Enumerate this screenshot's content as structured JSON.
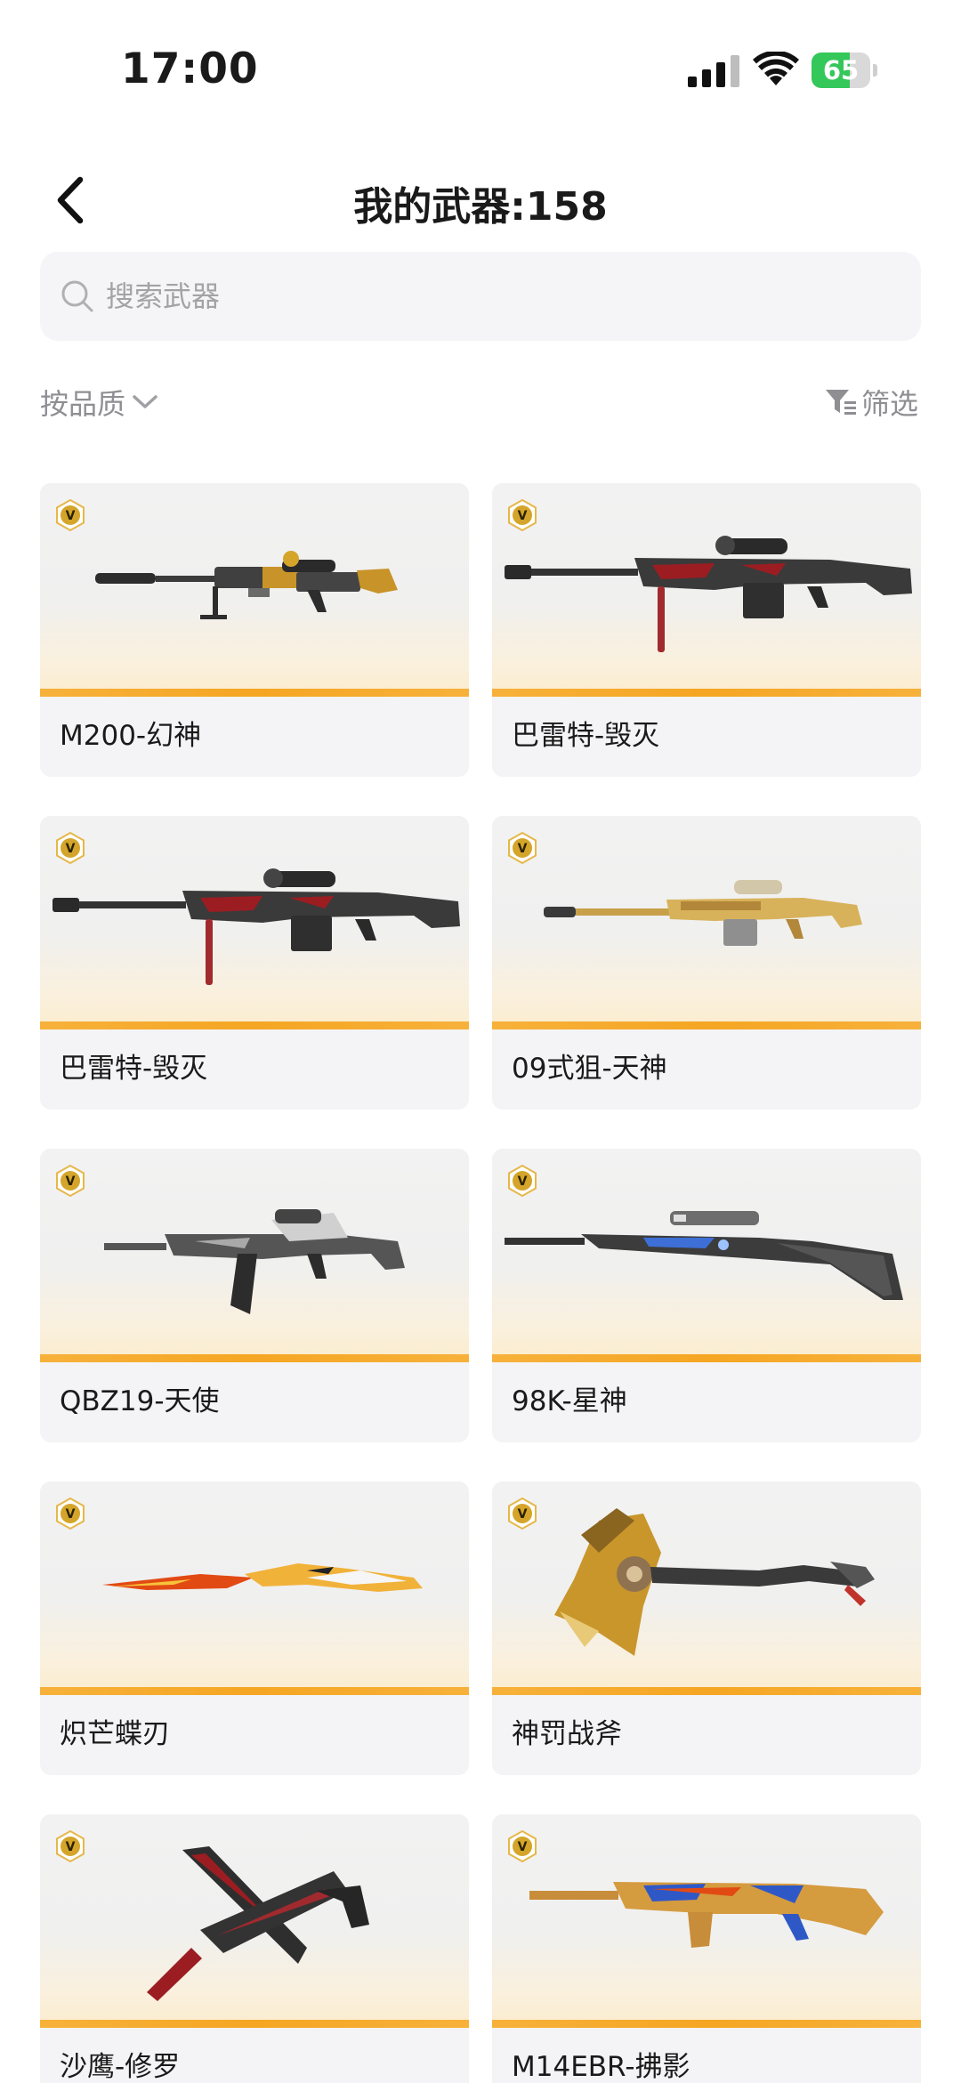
{
  "status_bar": {
    "time": "17:00",
    "battery_level": "65",
    "battery_fraction": 0.65
  },
  "header": {
    "title": "我的武器:158"
  },
  "search": {
    "placeholder": "搜索武器"
  },
  "filters": {
    "sort_label": "按品质",
    "filter_label": "筛选"
  },
  "weapons": [
    {
      "name": "M200-幻神",
      "icon": "sniper-rifle-gold-icon"
    },
    {
      "name": "巴雷特-毁灭",
      "icon": "sniper-rifle-red-icon"
    },
    {
      "name": "巴雷特-毁灭",
      "icon": "sniper-rifle-red-icon"
    },
    {
      "name": "09式狙-天神",
      "icon": "sniper-rifle-golden-icon"
    },
    {
      "name": "QBZ19-天使",
      "icon": "assault-rifle-angel-icon"
    },
    {
      "name": "98K-星神",
      "icon": "bolt-rifle-icon"
    },
    {
      "name": "炽芒蝶刃",
      "icon": "butterfly-knife-icon"
    },
    {
      "name": "神罚战斧",
      "icon": "battle-axe-icon"
    },
    {
      "name": "沙鹰-修罗",
      "icon": "pistol-knife-icon"
    },
    {
      "name": "M14EBR-拂影",
      "icon": "marksman-rifle-icon"
    }
  ],
  "colors": {
    "accent": "#f5a623",
    "battery": "#34c759",
    "muted_text": "#8e8e93",
    "card_bg": "#f4f4f6"
  }
}
